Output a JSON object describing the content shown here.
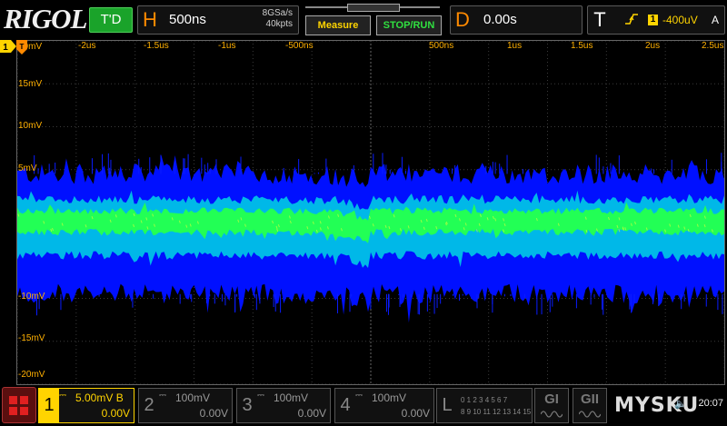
{
  "logo": "RIGOL",
  "trigger_state": "T'D",
  "horizontal": {
    "letter": "H",
    "timebase": "500ns",
    "sample_rate": "8GSa/s",
    "memory_depth": "40kpts"
  },
  "buttons": {
    "measure": "Measure",
    "stop_run": "STOP/RUN"
  },
  "delay": {
    "letter": "D",
    "value": "0.00s"
  },
  "trigger": {
    "letter": "T",
    "edge_icon": "rising-edge-icon",
    "channel": "1",
    "level": "-400uV",
    "mode": "A"
  },
  "time_labels": [
    "-2us",
    "-1.5us",
    "-1us",
    "-500ns",
    "500ns",
    "1us",
    "1.5us",
    "2us",
    "2.5us"
  ],
  "volt_labels": [
    "20mV",
    "15mV",
    "10mV",
    "5mV",
    "-10mV",
    "-15mV",
    "-20mV"
  ],
  "channels": [
    {
      "num": "1",
      "coupling": "DC",
      "scale": "5.00mV",
      "bw": "B",
      "offset": "0.00V",
      "active": true
    },
    {
      "num": "2",
      "coupling": "DC",
      "scale": "100mV",
      "bw": "",
      "offset": "0.00V",
      "active": false
    },
    {
      "num": "3",
      "coupling": "DC",
      "scale": "100mV",
      "bw": "",
      "offset": "0.00V",
      "active": false
    },
    {
      "num": "4",
      "coupling": "DC",
      "scale": "100mV",
      "bw": "",
      "offset": "0.00V",
      "active": false
    }
  ],
  "logic": {
    "letter": "L",
    "row1": "0 1 2 3 4 5 6 7",
    "row2": "8 9 10 11 12 13 14 15"
  },
  "generators": [
    {
      "label": "GI"
    },
    {
      "label": "GII"
    }
  ],
  "watermark": "MYSKU",
  "clock": "20:07",
  "colors": {
    "accent": "#ffd400",
    "trig_green": "#1aa32a",
    "label_orange": "#ffb000",
    "waveform_blue": "#0018ff",
    "waveform_green": "#21ff4a"
  },
  "chart_data": {
    "type": "area",
    "x_unit": "s",
    "xlim": [
      -2.5e-06,
      2.5e-06
    ],
    "ylim": [
      -0.02,
      0.02
    ],
    "x_ticks": [
      -2e-06,
      -1.5e-06,
      -1e-06,
      -5e-07,
      5e-07,
      1e-06,
      1.5e-06,
      2e-06,
      2.5e-06
    ],
    "y_ticks": [
      0.02,
      0.015,
      0.01,
      0.005,
      -0.01,
      -0.015,
      -0.02
    ],
    "series": [
      {
        "band_center_v": -0.0005,
        "outer_upper_v": 0.0045,
        "outer_lower_v": -0.0095,
        "inner_upper_v": 0.0015,
        "inner_lower_v": -0.005,
        "core_upper_v": 0.0002,
        "core_lower_v": -0.0023,
        "trigger_step_at_s": 0
      }
    ],
    "grid": true
  }
}
